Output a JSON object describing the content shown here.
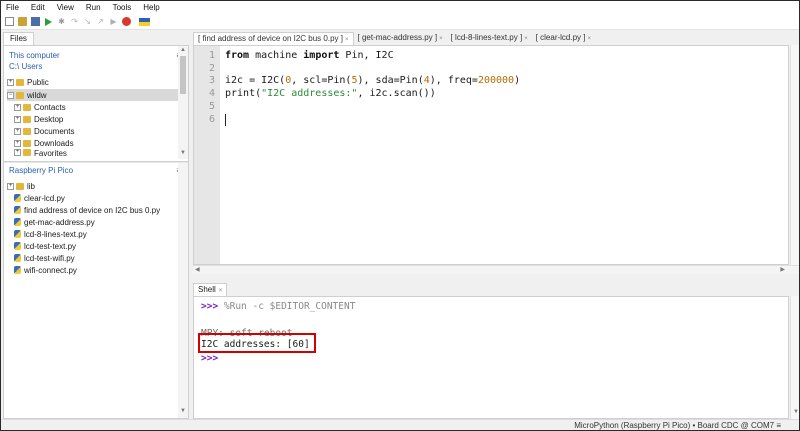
{
  "menu": [
    "File",
    "Edit",
    "View",
    "Run",
    "Tools",
    "Help"
  ],
  "icons": {
    "new": "new-file-icon",
    "open": "open-file-icon",
    "save": "save-icon",
    "run": "run-icon",
    "debug": "debug-icon",
    "stop": "stop-icon",
    "flag": "ukraine-flag-icon"
  },
  "colors": {
    "prompt": "#7a23c5",
    "string": "#2c8a3a",
    "number": "#b86a00",
    "highlight_box": "#d40000"
  },
  "files": {
    "tab_label": "Files",
    "computer": {
      "title": "This computer",
      "path": "C:\\ Users",
      "items": [
        "Public",
        "wildw",
        "Contacts",
        "Desktop",
        "Documents",
        "Downloads",
        "Favorites"
      ]
    },
    "pico": {
      "title": "Raspberry Pi Pico",
      "items": [
        "lib",
        "clear-lcd.py",
        "find address of device on I2C bus 0.py",
        "get-mac-address.py",
        "lcd-8-lines-text.py",
        "lcd-test-text.py",
        "lcd-test-wifi.py",
        "wifi-connect.py"
      ]
    },
    "menu_glyph": "≡"
  },
  "editor": {
    "tabs": [
      "[ find address of device on I2C bus 0.py ]",
      "[ get-mac-address.py ]",
      "[ lcd-8-lines-text.py ]",
      "[ clear-lcd.py ]"
    ],
    "close_glyph": "×",
    "line_numbers": [
      "1",
      "2",
      "3",
      "4",
      "5",
      "6"
    ],
    "code": {
      "l1_from": "from",
      "l1_mid": " machine ",
      "l1_import": "import",
      "l1_rest": " Pin, I2C",
      "l3_a": "i2c = I2C(",
      "l3_n0": "0",
      "l3_b": ", scl=Pin(",
      "l3_n5": "5",
      "l3_c": "), sda=Pin(",
      "l3_n4": "4",
      "l3_d": "), freq=",
      "l3_n200k": "200000",
      "l3_e": ")",
      "l4_a": "print(",
      "l4_str": "\"I2C addresses:\"",
      "l4_b": ", i2c.scan())"
    }
  },
  "shell": {
    "tab_label": "Shell",
    "close_glyph": "×",
    "prompt": ">>>",
    "run_command": " %Run -c $EDITOR_CONTENT",
    "soft_reboot": "MPY: soft reboot",
    "output": "I2C addresses: [60]"
  },
  "status": {
    "text": "MicroPython (Raspberry Pi Pico)  •  Board CDC @ COM7  ≡"
  }
}
